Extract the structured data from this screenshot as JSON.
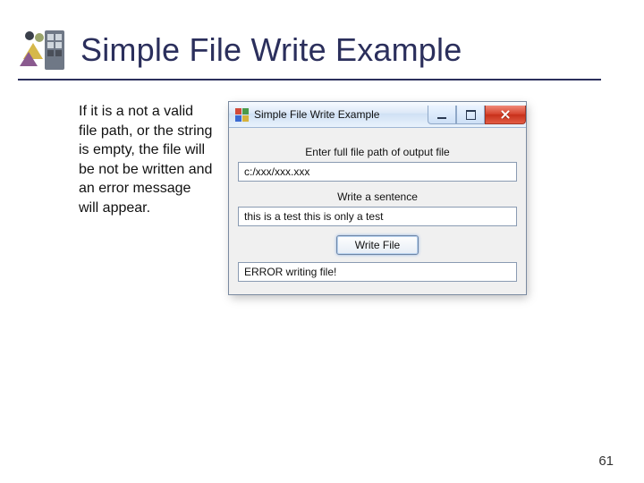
{
  "slide": {
    "title": "Simple File Write Example",
    "paragraph": "If it is a not a valid file path, or the string is empty, the file will be not be written and an error message will appear.",
    "page_number": "61"
  },
  "app": {
    "window_title": "Simple File Write Example",
    "label_path": "Enter full file path of output file",
    "input_path": "c:/xxx/xxx.xxx",
    "label_sentence": "Write a sentence",
    "input_sentence": "this is a test this is only a test",
    "button_write": "Write File",
    "status_text": "ERROR writing file!"
  },
  "icons": {
    "minimize": "minimize",
    "maximize": "maximize",
    "close": "close"
  }
}
